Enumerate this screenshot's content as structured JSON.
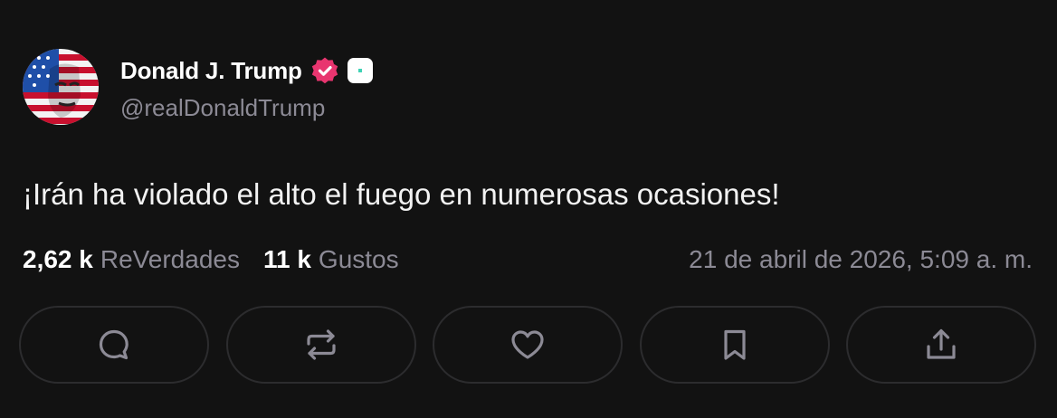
{
  "post": {
    "author": {
      "display_name": "Donald J. Trump",
      "handle": "@realDonaldTrump",
      "verified": true,
      "badge_color": "#e8356f",
      "affiliate_badge_color": "#3fd2b5"
    },
    "text": "¡Irán ha violado el alto el fuego en numerosas ocasiones!",
    "stats": {
      "reposts_count": "2,62 k",
      "reposts_label": "ReVerdades",
      "likes_count": "11 k",
      "likes_label": "Gustos"
    },
    "timestamp": "21 de abril de 2026, 5:09 a. m."
  },
  "actions": [
    {
      "name": "reply",
      "icon": "reply-icon"
    },
    {
      "name": "repost",
      "icon": "repost-icon"
    },
    {
      "name": "like",
      "icon": "heart-icon"
    },
    {
      "name": "bookmark",
      "icon": "bookmark-icon"
    },
    {
      "name": "share",
      "icon": "share-icon"
    }
  ],
  "colors": {
    "background": "#121212",
    "text_primary": "#ffffff",
    "text_secondary": "#8c8a95",
    "button_border": "#2c2c2e",
    "icon_color": "#8c8a95"
  }
}
